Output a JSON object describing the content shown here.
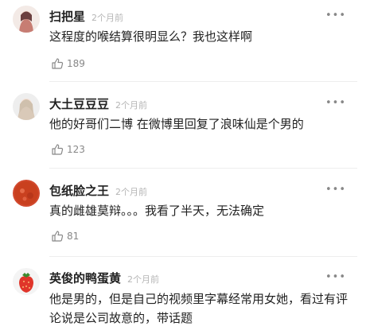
{
  "comments": [
    {
      "name": "扫把星",
      "time": "2个月前",
      "text": "这程度的喉结算很明显么？我也这样啊",
      "likes": "189",
      "more": "•••"
    },
    {
      "name": "大土豆豆豆",
      "time": "2个月前",
      "text": "他的好哥们二博 在微博里回复了浪味仙是个男的",
      "likes": "123",
      "more": "•••"
    },
    {
      "name": "包纸脸之王",
      "time": "2个月前",
      "text": "真的雌雄莫辩。。。我看了半天，无法确定",
      "likes": "81",
      "more": "•••"
    },
    {
      "name": "英俊的鸭蛋黄",
      "time": "2个月前",
      "text": "他是男的，但是自己的视频里字幕经常用女她，看过有评论说是公司故意的，带话题",
      "likes": "",
      "more": "•••"
    }
  ],
  "icons": {
    "like": "thumbs-up-icon",
    "more": "more-dots-icon"
  },
  "colors": {
    "name": "#222222",
    "time": "#b5b5b5",
    "like": "#888888"
  }
}
